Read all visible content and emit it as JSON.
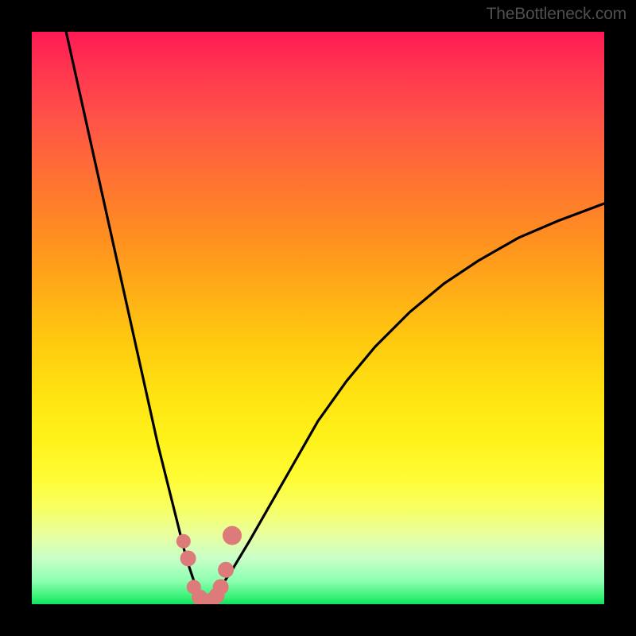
{
  "attribution": "TheBottleneck.com",
  "colors": {
    "frame": "#000000",
    "curve": "#000000",
    "points": "#dd7a7a",
    "gradient_top": "#ff1a55",
    "gradient_mid": "#fff21a",
    "gradient_bottom": "#10e060"
  },
  "chart_data": {
    "type": "line",
    "title": "",
    "xlabel": "",
    "ylabel": "",
    "xlim": [
      0,
      100
    ],
    "ylim": [
      0,
      100
    ],
    "series": [
      {
        "name": "bottleneck-curve",
        "x": [
          6,
          8,
          10,
          12,
          14,
          16,
          18,
          20,
          22,
          24,
          26,
          27,
          28,
          29,
          30,
          31,
          32,
          33,
          35,
          38,
          42,
          46,
          50,
          55,
          60,
          66,
          72,
          78,
          85,
          92,
          100
        ],
        "values": [
          100,
          91,
          82,
          73,
          64,
          55,
          46,
          37,
          28,
          20,
          12,
          8,
          5,
          2,
          0,
          0,
          1,
          3,
          6,
          11,
          18,
          25,
          32,
          39,
          45,
          51,
          56,
          60,
          64,
          67,
          70
        ]
      }
    ],
    "scatter_points": {
      "name": "highlighted-points",
      "x": [
        26.5,
        27.3,
        28.3,
        29.3,
        30.3,
        31.3,
        32.3,
        33.0,
        33.9,
        35.0
      ],
      "y": [
        11.0,
        8.0,
        3.0,
        1.2,
        0.5,
        0.6,
        1.5,
        3.0,
        6.0,
        12.0
      ],
      "radius": [
        9,
        10,
        9,
        10,
        10,
        10,
        10,
        10,
        10,
        12
      ]
    }
  }
}
